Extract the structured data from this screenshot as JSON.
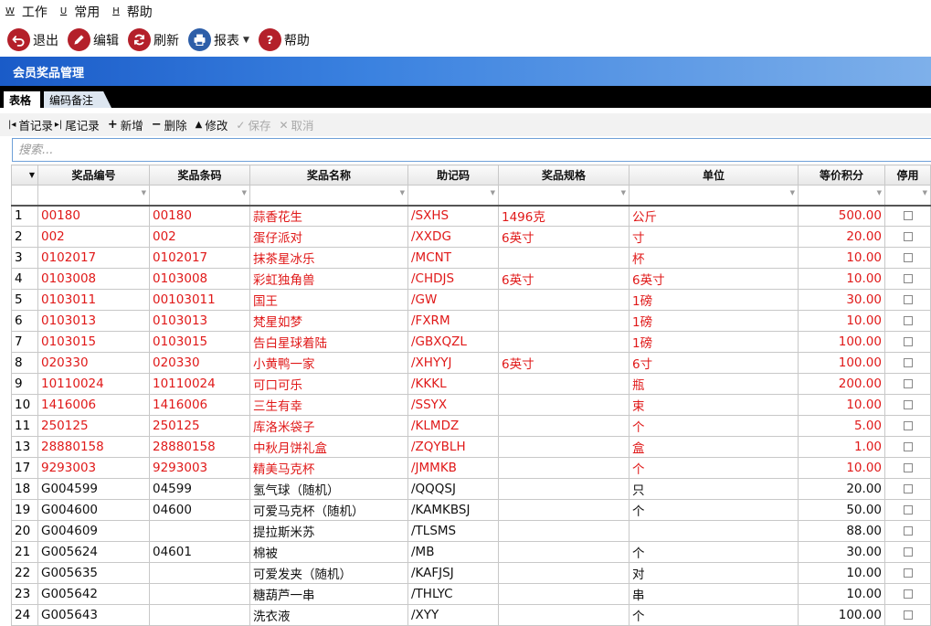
{
  "menubar": {
    "items": [
      {
        "mnemonic": "W",
        "label": "工作"
      },
      {
        "mnemonic": "U",
        "label": "常用"
      },
      {
        "mnemonic": "H",
        "label": "帮助"
      }
    ]
  },
  "toolbar": {
    "exit": "退出",
    "edit": "编辑",
    "refresh": "刷新",
    "report": "报表",
    "help": "帮助"
  },
  "module": {
    "title": "会员奖品管理"
  },
  "tabs": {
    "table": "表格",
    "code_note": "编码备注"
  },
  "records_bar": {
    "first": "首记录",
    "last": "尾记录",
    "add": "新增",
    "delete": "删除",
    "modify": "修改",
    "save": "保存",
    "cancel": "取消"
  },
  "search": {
    "placeholder": "搜索..."
  },
  "grid": {
    "columns": [
      "奖品编号",
      "奖品条码",
      "奖品名称",
      "助记码",
      "奖品规格",
      "单位",
      "等价积分",
      "停用"
    ],
    "rows": [
      {
        "n": "1",
        "code": "00180",
        "barcode": "00180",
        "name": "蒜香花生",
        "mnemonic": "/SXHS",
        "spec": "1496克",
        "unit": "公斤",
        "points": "500.00",
        "color": "red"
      },
      {
        "n": "2",
        "code": "002",
        "barcode": "002",
        "name": "蛋仔派对",
        "mnemonic": "/XXDG",
        "spec": "6英寸",
        "unit": "寸",
        "points": "20.00",
        "color": "red"
      },
      {
        "n": "3",
        "code": "0102017",
        "barcode": "0102017",
        "name": "抹茶星冰乐",
        "mnemonic": "/MCNT",
        "spec": "",
        "unit": "杯",
        "points": "10.00",
        "color": "red"
      },
      {
        "n": "4",
        "code": "0103008",
        "barcode": "0103008",
        "name": "彩虹独角兽",
        "mnemonic": "/CHDJS",
        "spec": "6英寸",
        "unit": "6英寸",
        "points": "10.00",
        "color": "red"
      },
      {
        "n": "5",
        "code": "0103011",
        "barcode": "00103011",
        "name": "国王",
        "mnemonic": "/GW",
        "spec": "",
        "unit": "1磅",
        "points": "30.00",
        "color": "red"
      },
      {
        "n": "6",
        "code": "0103013",
        "barcode": "0103013",
        "name": "梵星如梦",
        "mnemonic": "/FXRM",
        "spec": "",
        "unit": "1磅",
        "points": "10.00",
        "color": "red"
      },
      {
        "n": "7",
        "code": "0103015",
        "barcode": "0103015",
        "name": "告白星球着陆",
        "mnemonic": "/GBXQZL",
        "spec": "",
        "unit": "1磅",
        "points": "100.00",
        "color": "red"
      },
      {
        "n": "8",
        "code": "020330",
        "barcode": "020330",
        "name": "小黄鸭一家",
        "mnemonic": "/XHYYJ",
        "spec": "6英寸",
        "unit": "6寸",
        "points": "100.00",
        "color": "red"
      },
      {
        "n": "9",
        "code": "10110024",
        "barcode": "10110024",
        "name": "可口可乐",
        "mnemonic": "/KKKL",
        "spec": "",
        "unit": "瓶",
        "points": "200.00",
        "color": "red"
      },
      {
        "n": "10",
        "code": "1416006",
        "barcode": "1416006",
        "name": "三生有幸",
        "mnemonic": "/SSYX",
        "spec": "",
        "unit": "束",
        "points": "10.00",
        "color": "red"
      },
      {
        "n": "11",
        "code": "250125",
        "barcode": "250125",
        "name": "库洛米袋子",
        "mnemonic": "/KLMDZ",
        "spec": "",
        "unit": "个",
        "points": "5.00",
        "color": "red"
      },
      {
        "n": "13",
        "code": "28880158",
        "barcode": "28880158",
        "name": "中秋月饼礼盒",
        "mnemonic": "/ZQYBLH",
        "spec": "",
        "unit": "盒",
        "points": "1.00",
        "color": "red"
      },
      {
        "n": "17",
        "code": "9293003",
        "barcode": "9293003",
        "name": "精美马克杯",
        "mnemonic": "/JMMKB",
        "spec": "",
        "unit": "个",
        "points": "10.00",
        "color": "red"
      },
      {
        "n": "18",
        "code": "G004599",
        "barcode": "04599",
        "name": "氢气球（随机）",
        "mnemonic": "/QQQSJ",
        "spec": "",
        "unit": "只",
        "points": "20.00",
        "color": "black"
      },
      {
        "n": "19",
        "code": "G004600",
        "barcode": "04600",
        "name": "可爱马克杯（随机）",
        "mnemonic": "/KAMKBSJ",
        "spec": "",
        "unit": "个",
        "points": "50.00",
        "color": "black"
      },
      {
        "n": "20",
        "code": "G004609",
        "barcode": "",
        "name": "提拉斯米苏",
        "mnemonic": "/TLSMS",
        "spec": "",
        "unit": "",
        "points": "88.00",
        "color": "black"
      },
      {
        "n": "21",
        "code": "G005624",
        "barcode": "04601",
        "name": "棉被",
        "mnemonic": "/MB",
        "spec": "",
        "unit": "个",
        "points": "30.00",
        "color": "black"
      },
      {
        "n": "22",
        "code": "G005635",
        "barcode": "",
        "name": "可爱发夹（随机）",
        "mnemonic": "/KAFJSJ",
        "spec": "",
        "unit": "对",
        "points": "10.00",
        "color": "black"
      },
      {
        "n": "23",
        "code": "G005642",
        "barcode": "",
        "name": "糖葫芦一串",
        "mnemonic": "/THLYC",
        "spec": "",
        "unit": "串",
        "points": "10.00",
        "color": "black"
      },
      {
        "n": "24",
        "code": "G005643",
        "barcode": "",
        "name": "洗衣液",
        "mnemonic": "/XYY",
        "spec": "",
        "unit": "个",
        "points": "100.00",
        "color": "black"
      }
    ]
  },
  "colors": {
    "accent_blue": "#1a5bc8",
    "inactive_red_text": "#e01919",
    "icon_red": "#b4202a"
  }
}
